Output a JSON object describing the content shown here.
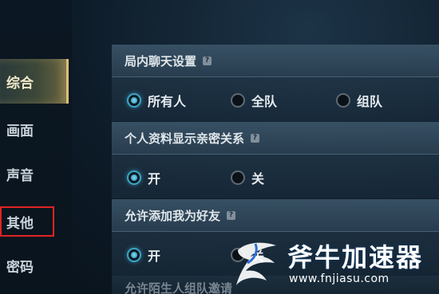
{
  "sidebar": {
    "items": [
      {
        "label": "综合",
        "active": true
      },
      {
        "label": "画面"
      },
      {
        "label": "声音"
      },
      {
        "label": "其他",
        "highlighted": true
      },
      {
        "label": "密码"
      }
    ]
  },
  "sections": [
    {
      "title": "局内聊天设置",
      "help": "?",
      "options": [
        {
          "label": "所有人",
          "selected": true
        },
        {
          "label": "全队",
          "selected": false
        },
        {
          "label": "组队",
          "selected": false
        }
      ]
    },
    {
      "title": "个人资料显示亲密关系",
      "help": "?",
      "options": [
        {
          "label": "开",
          "selected": true
        },
        {
          "label": "关",
          "selected": false
        }
      ]
    },
    {
      "title": "允许添加我为好友",
      "help": "?",
      "options": [
        {
          "label": "开",
          "selected": true
        },
        {
          "label": "关",
          "selected": false
        }
      ]
    }
  ],
  "partial_section_title": "允许陌生人组队邀请",
  "watermark": {
    "title": "斧牛加速器",
    "url": "www.fnjiasu.com"
  },
  "colors": {
    "accent": "#3fa3c2",
    "active_tab": "#d8c07a",
    "highlight_frame": "#e02424"
  }
}
